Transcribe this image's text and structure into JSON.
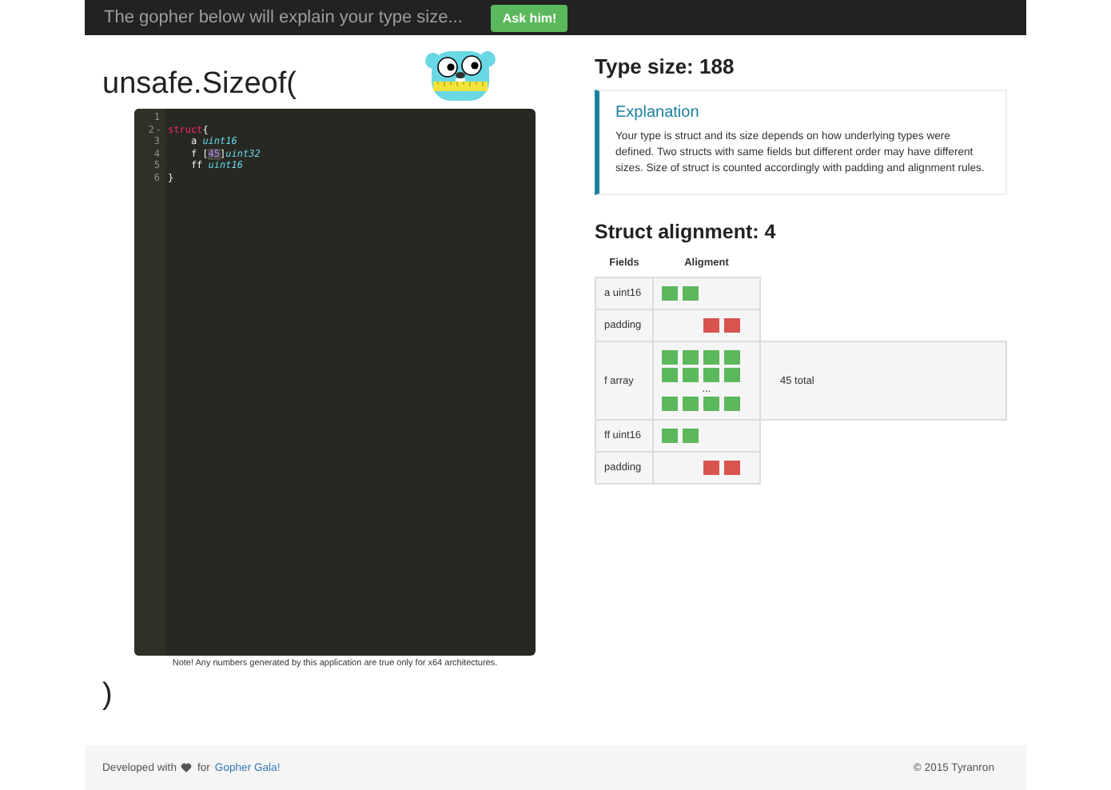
{
  "navbar": {
    "text": "The gopher below will explain your type size...",
    "button": "Ask him!"
  },
  "heading_open": "unsafe.Sizeof(",
  "editor": {
    "lines": [
      {
        "number": "1"
      },
      {
        "number": "2",
        "fold_marker": "-",
        "tokens": [
          {
            "kind": "keyword",
            "text": "struct"
          },
          {
            "kind": "plain",
            "text": "{"
          }
        ]
      },
      {
        "number": "3",
        "tokens": [
          {
            "kind": "plain",
            "text": "    a "
          },
          {
            "kind": "type",
            "text": "uint16"
          }
        ]
      },
      {
        "number": "4",
        "tokens": [
          {
            "kind": "plain",
            "text": "    f ["
          },
          {
            "kind": "number",
            "text": "45"
          },
          {
            "kind": "plain",
            "text": "]"
          },
          {
            "kind": "type",
            "text": "uint32"
          }
        ]
      },
      {
        "number": "5",
        "tokens": [
          {
            "kind": "plain",
            "text": "    ff "
          },
          {
            "kind": "type",
            "text": "uint16"
          }
        ]
      },
      {
        "number": "6",
        "tokens": [
          {
            "kind": "plain",
            "text": "}"
          }
        ]
      }
    ]
  },
  "note": "Note! Any numbers generated by this application are true only for x64 architectures.",
  "heading_close": ")",
  "type_size": "Type size: 188",
  "explanation": {
    "title": "Explanation",
    "text": "Your type is struct and its size depends on how underlying types were defined. Two structs with same fields but different order may have different sizes. Size of struct is counted accordingly with padding and alignment rules."
  },
  "struct_alignment": "Struct alignment: 4",
  "table": {
    "columns": [
      "Fields",
      "Aligment"
    ],
    "rows": [
      {
        "field": "a uint16",
        "lines": [
          {
            "kind": "blocks",
            "blocks": [
              {
                "filled": true,
                "padding": false
              },
              {
                "filled": true,
                "padding": false
              },
              {
                "filled": false
              },
              {
                "filled": false
              }
            ]
          }
        ]
      },
      {
        "field": "padding",
        "lines": [
          {
            "kind": "blocks",
            "blocks": [
              {
                "filled": false
              },
              {
                "filled": false
              },
              {
                "filled": true,
                "padding": true
              },
              {
                "filled": true,
                "padding": true
              }
            ]
          }
        ]
      },
      {
        "field": "f array",
        "total": "45 total",
        "lines": [
          {
            "kind": "blocks",
            "blocks": [
              {
                "filled": true,
                "padding": false
              },
              {
                "filled": true,
                "padding": false
              },
              {
                "filled": true,
                "padding": false
              },
              {
                "filled": true,
                "padding": false
              }
            ]
          },
          {
            "kind": "blocks",
            "blocks": [
              {
                "filled": true,
                "padding": false
              },
              {
                "filled": true,
                "padding": false
              },
              {
                "filled": true,
                "padding": false
              },
              {
                "filled": true,
                "padding": false
              }
            ]
          },
          {
            "kind": "ellipsis",
            "text": "..."
          },
          {
            "kind": "blocks",
            "blocks": [
              {
                "filled": true,
                "padding": false
              },
              {
                "filled": true,
                "padding": false
              },
              {
                "filled": true,
                "padding": false
              },
              {
                "filled": true,
                "padding": false
              }
            ]
          }
        ]
      },
      {
        "field": "ff uint16",
        "lines": [
          {
            "kind": "blocks",
            "blocks": [
              {
                "filled": true,
                "padding": false
              },
              {
                "filled": true,
                "padding": false
              },
              {
                "filled": false
              },
              {
                "filled": false
              }
            ]
          }
        ]
      },
      {
        "field": "padding",
        "lines": [
          {
            "kind": "blocks",
            "blocks": [
              {
                "filled": false
              },
              {
                "filled": false
              },
              {
                "filled": true,
                "padding": true
              },
              {
                "filled": true,
                "padding": true
              }
            ]
          }
        ]
      }
    ]
  },
  "footer": {
    "prefix": "Developed with",
    "middle": "for",
    "link": "Gopher Gala!",
    "copyright": "© 2015 Tyranron"
  }
}
